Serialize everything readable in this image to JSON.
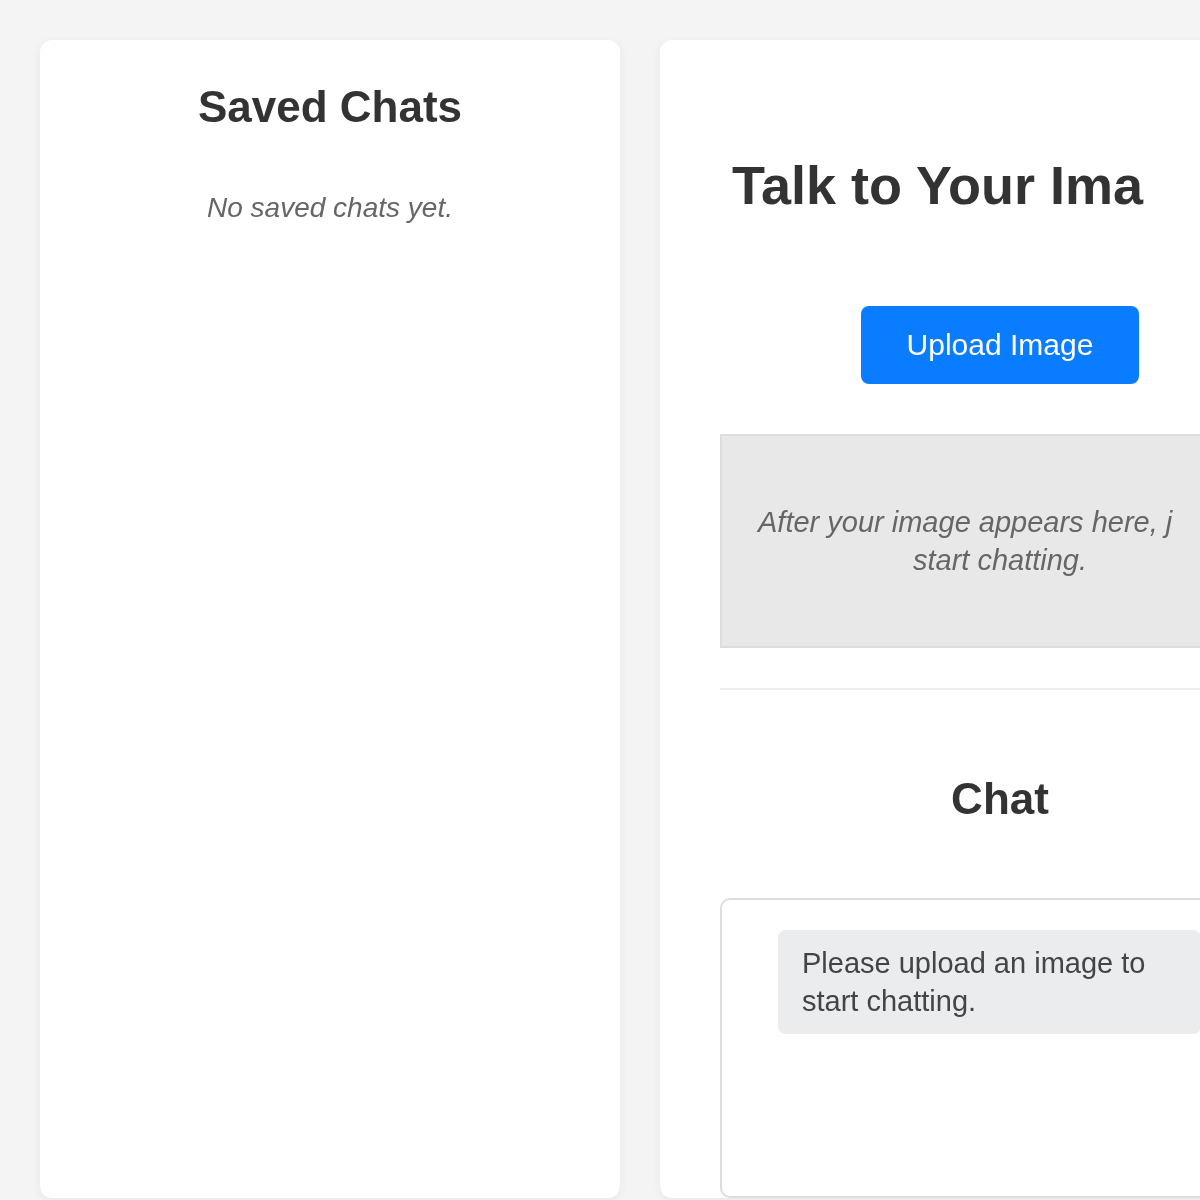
{
  "sidebar": {
    "title": "Saved Chats",
    "empty_message": "No saved chats yet."
  },
  "main": {
    "title": "Talk to Your Ima",
    "upload_button": "Upload Image",
    "image_placeholder": [
      "After your image appears here, j",
      "start chatting."
    ],
    "chat": {
      "title": "Chat",
      "messages": [
        {
          "kind": "system",
          "text": "Please upload an image to start chatting."
        }
      ]
    }
  }
}
